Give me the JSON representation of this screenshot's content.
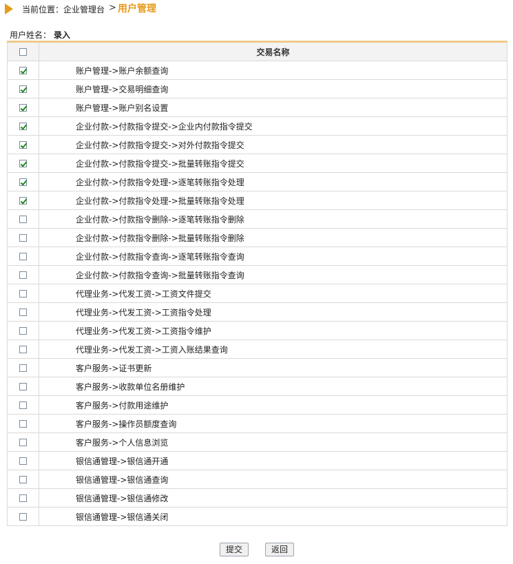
{
  "breadcrumb": {
    "label": "当前位置：企业管理台",
    "separator": ">",
    "current": "用户管理"
  },
  "user": {
    "label": "用户姓名：",
    "name": "录入"
  },
  "table": {
    "header": "交易名称",
    "rows": [
      {
        "name": "账户管理->账户余额查询",
        "checked": true
      },
      {
        "name": "账户管理->交易明细查询",
        "checked": true
      },
      {
        "name": "账户管理->账户别名设置",
        "checked": true
      },
      {
        "name": "企业付款->付款指令提交->企业内付款指令提交",
        "checked": true
      },
      {
        "name": "企业付款->付款指令提交->对外付款指令提交",
        "checked": true
      },
      {
        "name": "企业付款->付款指令提交->批量转账指令提交",
        "checked": true
      },
      {
        "name": "企业付款->付款指令处理->逐笔转账指令处理",
        "checked": true
      },
      {
        "name": "企业付款->付款指令处理->批量转账指令处理",
        "checked": true
      },
      {
        "name": "企业付款->付款指令删除->逐笔转账指令删除",
        "checked": false
      },
      {
        "name": "企业付款->付款指令删除->批量转账指令删除",
        "checked": false
      },
      {
        "name": "企业付款->付款指令查询->逐笔转账指令查询",
        "checked": false
      },
      {
        "name": "企业付款->付款指令查询->批量转账指令查询",
        "checked": false
      },
      {
        "name": "代理业务->代发工资->工资文件提交",
        "checked": false
      },
      {
        "name": "代理业务->代发工资->工资指令处理",
        "checked": false
      },
      {
        "name": "代理业务->代发工资->工资指令维护",
        "checked": false
      },
      {
        "name": "代理业务->代发工资->工资入账结果查询",
        "checked": false
      },
      {
        "name": "客户服务->证书更新",
        "checked": false
      },
      {
        "name": "客户服务->收款单位名册维护",
        "checked": false
      },
      {
        "name": "客户服务->付款用途维护",
        "checked": false
      },
      {
        "name": "客户服务->操作员额度查询",
        "checked": false
      },
      {
        "name": "客户服务->个人信息浏览",
        "checked": false
      },
      {
        "name": "银信通管理->银信通开通",
        "checked": false
      },
      {
        "name": "银信通管理->银信通查询",
        "checked": false
      },
      {
        "name": "银信通管理->银信通修改",
        "checked": false
      },
      {
        "name": "银信通管理->银信通关闭",
        "checked": false
      }
    ]
  },
  "buttons": {
    "submit": "提交",
    "back": "返回"
  },
  "colors": {
    "accent": "#e59a19",
    "header_bar": "#f0c98a",
    "check": "#1a8a1a"
  }
}
